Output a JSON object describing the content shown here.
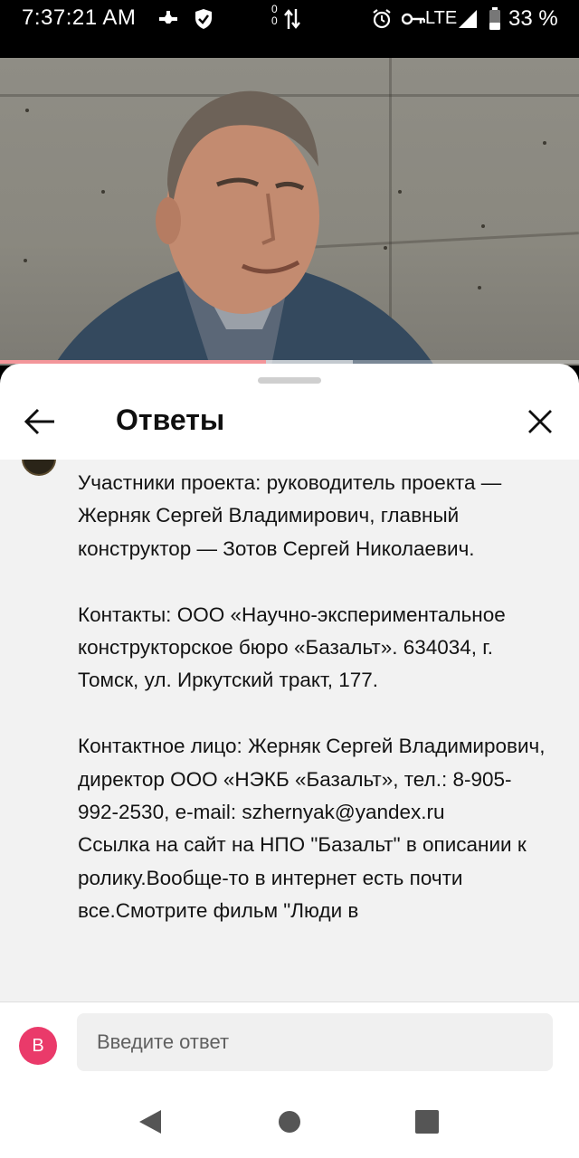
{
  "status_bar": {
    "time": "7:37:21 AM",
    "network_up": "0",
    "network_down": "0",
    "lte": "LTE",
    "battery": "33 %"
  },
  "video": {
    "progress_fraction": 0.46,
    "buffer_fraction": 0.61,
    "progress_color": "#e5181f"
  },
  "sheet": {
    "title": "Ответы",
    "reply_text": "Участники проекта: руководитель проекта — Жерняк Сергей Владимирович, главный конструктор — Зотов Сергей Николаевич.\n\nКонтакты: ООО «Научно-экспериментальное конструкторское бюро «Базальт». 634034, г. Томск, ул. Иркутский тракт, 177.\n\nКонтактное лицо: Жерняк Сергей Владимирович, директор ООО «НЭКБ «Базальт», тел.: 8-905-992-2530, e-mail: szhernyak@yandex.ru\nСсылка на сайт на НПО \"Базальт\" в описании к ролику.Вообще-то в интернет есть почти все.Смотрите фильм \"Люди в"
  },
  "composer": {
    "avatar_letter": "В",
    "avatar_color": "#ea3a6a",
    "placeholder": "Введите ответ"
  },
  "icons": {
    "back": "arrow-left-icon",
    "close": "close-icon",
    "nav_back": "triangle-back-icon",
    "nav_home": "circle-home-icon",
    "nav_recents": "square-recents-icon"
  }
}
